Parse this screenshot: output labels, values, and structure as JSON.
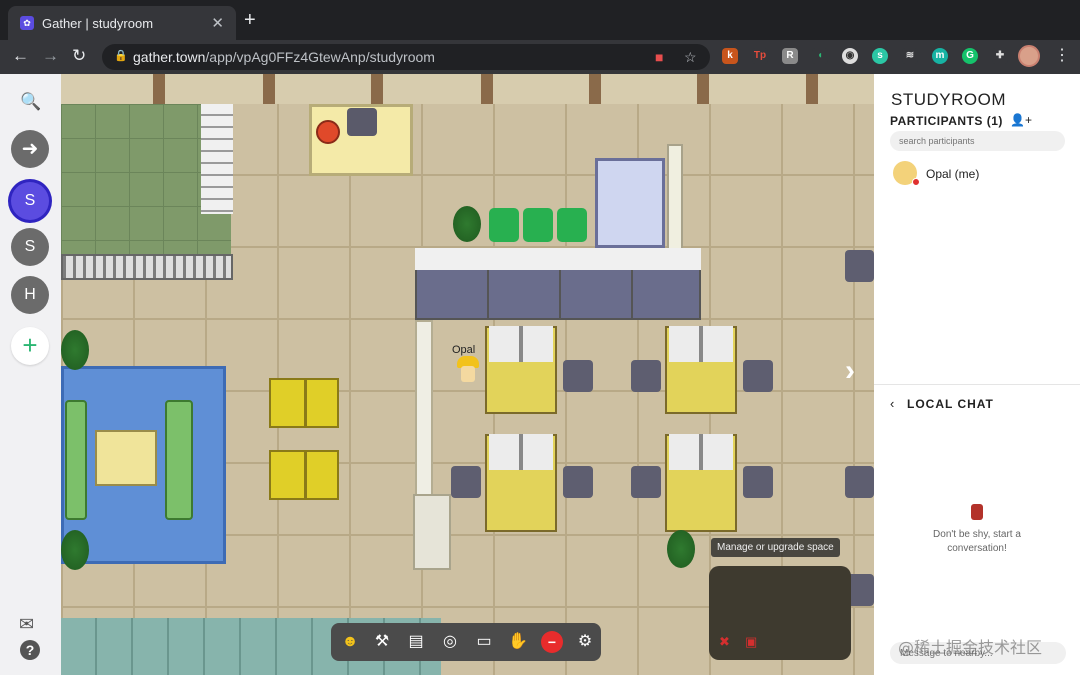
{
  "browser": {
    "tab_title": "Gather | studyroom",
    "tab_close": "✕",
    "new_tab": "+",
    "url_host": "gather.town",
    "url_path": "/app/vpAg0FFz4GtewAnp/studyroom",
    "icons": [
      "back-icon",
      "forward-icon",
      "reload-icon",
      "lock-icon",
      "bookmark-star-icon",
      "extensions-icon",
      "profile-avatar",
      "menu-icon"
    ]
  },
  "sidebar": {
    "spaces": [
      {
        "letter": "S",
        "color": "#5b4ce0",
        "active": true
      },
      {
        "letter": "S",
        "color": "#6b6b6b",
        "active": false
      },
      {
        "letter": "H",
        "color": "#6b6b6b",
        "active": false
      }
    ],
    "add_label": "+"
  },
  "map": {
    "avatar_name": "Opal",
    "manage_tip": "Manage or upgrade space",
    "toolbar_icons": [
      "avatar-icon",
      "build-hammer-icon",
      "map-icon",
      "target-icon",
      "screen-share-icon",
      "raise-hand-icon",
      "do-not-disturb-icon",
      "settings-gear-icon"
    ]
  },
  "panel": {
    "room_title": "STUDYROOM",
    "participants_heading": "PARTICIPANTS (1)",
    "search_placeholder": "search participants",
    "participants": [
      {
        "name": "Opal (me)"
      }
    ],
    "chat_heading": "LOCAL CHAT",
    "chat_empty": "Don't be shy, start a conversation!",
    "chat_placeholder": "Message to nearby..."
  },
  "watermark": "@稀土掘金技术社区",
  "colors": {
    "accent": "#5b4ce0",
    "add": "#2bb673",
    "stop": "#e82c2c"
  }
}
